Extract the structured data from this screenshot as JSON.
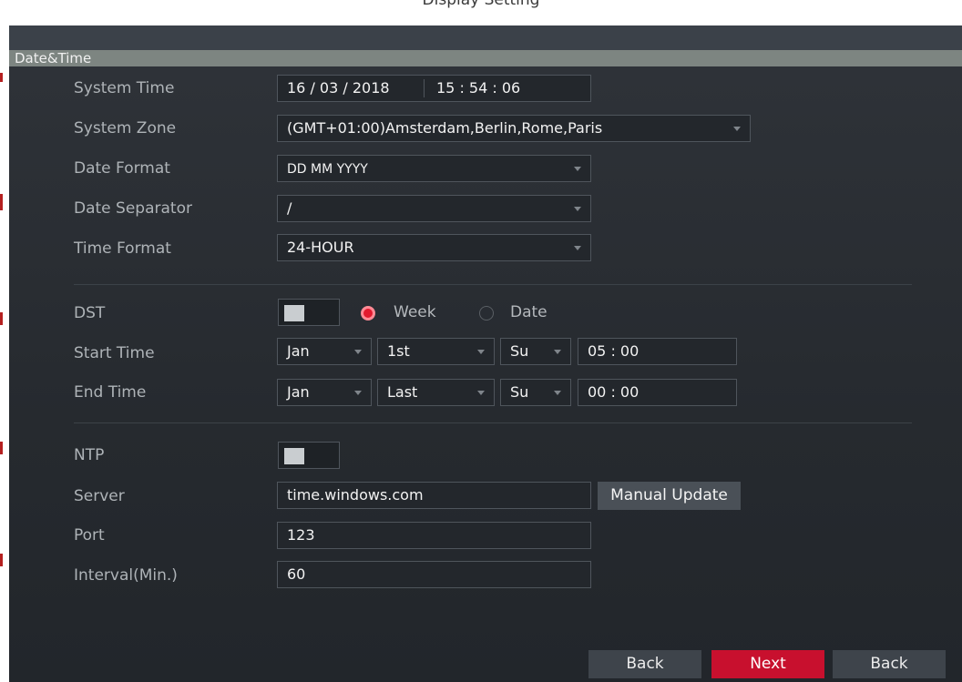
{
  "window": {
    "title": "Display Setting"
  },
  "section": {
    "title": "Date&Time"
  },
  "labels": {
    "system_time": "System Time",
    "system_zone": "System Zone",
    "date_format": "Date Format",
    "date_separator": "Date Separator",
    "time_format": "Time Format",
    "dst": "DST",
    "start_time": "Start Time",
    "end_time": "End Time",
    "ntp": "NTP",
    "server": "Server",
    "port": "Port",
    "interval": "Interval(Min.)"
  },
  "system_time": {
    "date": "16 / 03 / 2018",
    "time": "15 : 54 : 06"
  },
  "system_zone": {
    "value": "(GMT+01:00)Amsterdam,Berlin,Rome,Paris"
  },
  "date_format": {
    "value": "DD MM YYYY"
  },
  "date_separator": {
    "value": "/"
  },
  "time_format": {
    "value": "24-HOUR"
  },
  "dst": {
    "enabled": false,
    "mode_week": "Week",
    "mode_date": "Date",
    "selected": "Week"
  },
  "start_time": {
    "month": "Jan",
    "week": "1st",
    "day": "Su",
    "time": "05 : 00"
  },
  "end_time": {
    "month": "Jan",
    "week": "Last",
    "day": "Su",
    "time": "00 : 00"
  },
  "ntp": {
    "enabled": false
  },
  "server": {
    "value": "time.windows.com",
    "manual_update": "Manual Update"
  },
  "port": {
    "value": "123"
  },
  "interval": {
    "value": "60"
  },
  "buttons": {
    "back": "Back",
    "next": "Next",
    "back2": "Back"
  },
  "colors": {
    "accent": "#c8102e",
    "panel": "#2b2f34",
    "section_bar": "#7d8581"
  }
}
